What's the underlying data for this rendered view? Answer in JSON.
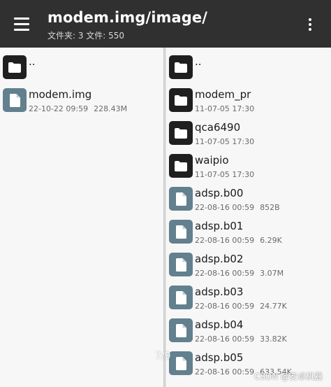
{
  "header": {
    "title": "modem.img/image/",
    "subtitle": "文件夹: 3  文件: 550",
    "menu_icon": "hamburger-menu-icon",
    "more_icon": "more-vertical-icon"
  },
  "left_pane": {
    "items": [
      {
        "type": "folder",
        "name": "..",
        "date": "",
        "size": ""
      },
      {
        "type": "file",
        "name": "modem.img",
        "date": "22-10-22 09:59",
        "size": "228.43M"
      }
    ]
  },
  "right_pane": {
    "items": [
      {
        "type": "folder",
        "name": "..",
        "date": "",
        "size": ""
      },
      {
        "type": "folder",
        "name": "modem_pr",
        "date": "11-07-05 17:30",
        "size": ""
      },
      {
        "type": "folder",
        "name": "qca6490",
        "date": "11-07-05 17:30",
        "size": ""
      },
      {
        "type": "folder",
        "name": "waipio",
        "date": "11-07-05 17:30",
        "size": ""
      },
      {
        "type": "file",
        "name": "adsp.b00",
        "date": "22-08-16 00:59",
        "size": "852B"
      },
      {
        "type": "file",
        "name": "adsp.b01",
        "date": "22-08-16 00:59",
        "size": "6.29K"
      },
      {
        "type": "file",
        "name": "adsp.b02",
        "date": "22-08-16 00:59",
        "size": "3.07M"
      },
      {
        "type": "file",
        "name": "adsp.b03",
        "date": "22-08-16 00:59",
        "size": "24.77K"
      },
      {
        "type": "file",
        "name": "adsp.b04",
        "date": "22-08-16 00:59",
        "size": "33.82K"
      },
      {
        "type": "file",
        "name": "adsp.b05",
        "date": "22-08-16 00:59",
        "size": "633.54K"
      }
    ]
  },
  "page_indicator": "7/9",
  "watermark": "CSDN @安卓机器",
  "colors": {
    "topbar": "#303030",
    "folder_icon_bg": "#1f1f1f",
    "file_icon_bg": "#62808e",
    "pane_bg": "#f7f7f7"
  }
}
